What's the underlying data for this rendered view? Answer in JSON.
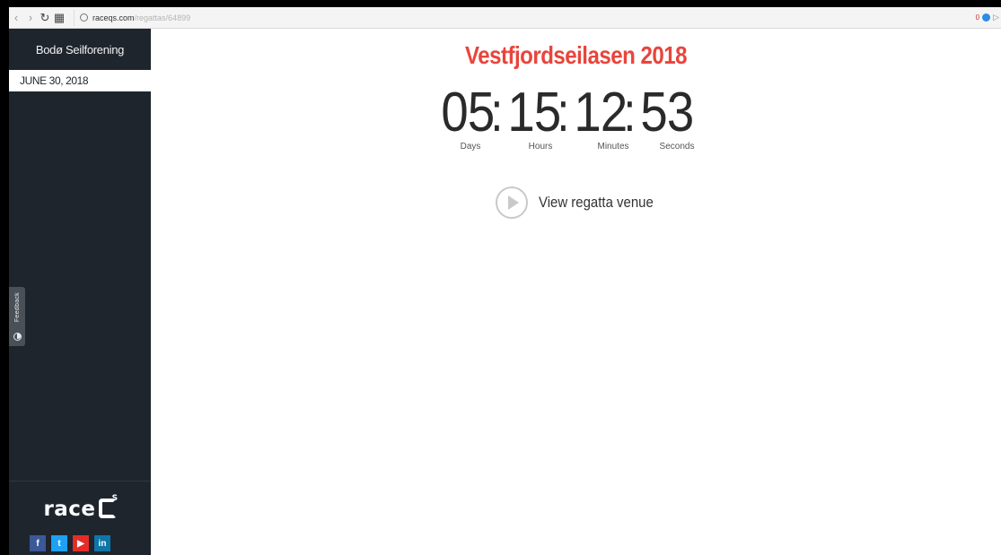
{
  "browser": {
    "url_host": "raceqs.com",
    "url_path": "/regattas/64899",
    "ext_badge": "0"
  },
  "sidebar": {
    "club_name": "Bodø Seilforening",
    "date_item": "JUNE 30, 2018",
    "feedback_label": "Feedback",
    "logo_text": "race",
    "logo_sup": "S"
  },
  "social": {
    "facebook": "f",
    "twitter": "t",
    "youtube": "▶",
    "linkedin": "in"
  },
  "main": {
    "title": "Vestfjordseilasen 2018",
    "countdown": {
      "days": "05",
      "hours": "15",
      "minutes": "12",
      "seconds": "53",
      "separator": ":",
      "days_label": "Days",
      "hours_label": "Hours",
      "minutes_label": "Minutes",
      "seconds_label": "Seconds"
    },
    "venue_label": "View regatta venue"
  },
  "colors": {
    "sidebar_bg": "#1e252d",
    "title_red": "#e8453c"
  }
}
